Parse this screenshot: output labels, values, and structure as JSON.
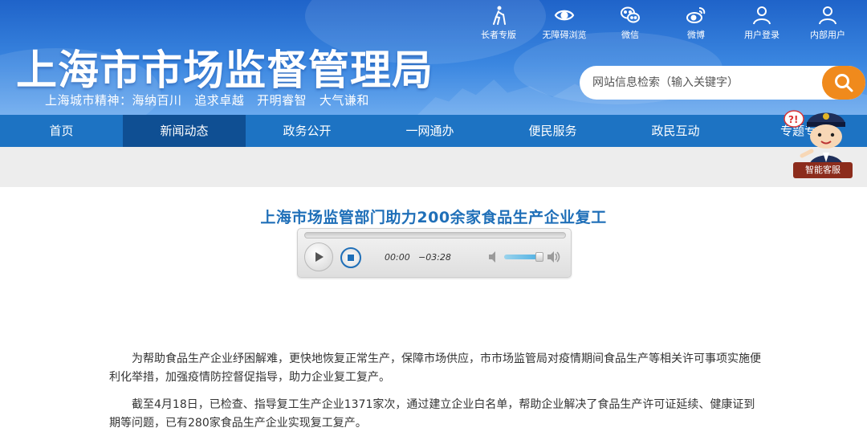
{
  "site": {
    "title": "上海市市场监督管理局",
    "slogan": "上海城市精神：海纳百川   追求卓越   开明睿智   大气谦和"
  },
  "top_links": [
    {
      "label": "长者专版",
      "icon": "elder-icon"
    },
    {
      "label": "无障碍浏览",
      "icon": "eye-icon"
    },
    {
      "label": "微信",
      "icon": "wechat-icon"
    },
    {
      "label": "微博",
      "icon": "weibo-icon"
    },
    {
      "label": "用户登录",
      "icon": "user-icon"
    },
    {
      "label": "内部用户",
      "icon": "user-icon"
    }
  ],
  "search": {
    "placeholder": "网站信息检索（输入关键字）",
    "icon": "search-icon"
  },
  "nav": [
    {
      "label": "首页",
      "active": false
    },
    {
      "label": "新闻动态",
      "active": true
    },
    {
      "label": "政务公开",
      "active": false
    },
    {
      "label": "一网通办",
      "active": false
    },
    {
      "label": "便民服务",
      "active": false
    },
    {
      "label": "政民互动",
      "active": false
    },
    {
      "label": "专题专",
      "active": false
    }
  ],
  "assistant": {
    "label": "智能客服",
    "bubble": "?!"
  },
  "article": {
    "title": "上海市场监管部门助力200余家食品生产企业复工",
    "player": {
      "current_time": "00:00",
      "remaining_time": "−03:28",
      "progress": 0,
      "volume": 0.85
    },
    "paragraphs": [
      "为帮助食品生产企业纾困解难，更快地恢复正常生产，保障市场供应，市市场监管局对疫情期间食品生产等相关许可事项实施便利化举措，加强疫情防控督促指导，助力企业复工复产。",
      "截至4月18日，已检查、指导复工生产企业1371家次，通过建立企业白名单，帮助企业解决了食品生产许可证延续、健康证到期等问题，已有280家食品生产企业实现复工复产。"
    ]
  },
  "colors": {
    "header_top": "#1f63c9",
    "nav_bg": "#1d73c3",
    "nav_active": "#0f4f93",
    "search_button": "#f08a1c",
    "title_color": "#1f6fb8"
  }
}
